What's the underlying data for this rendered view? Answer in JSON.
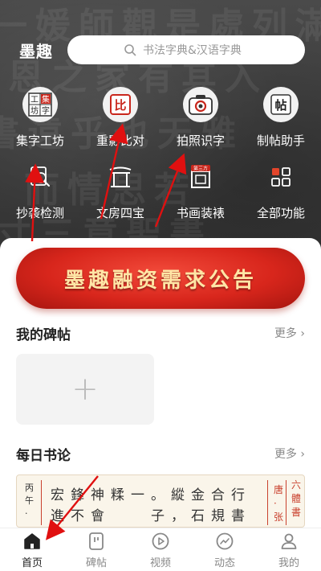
{
  "header": {
    "app_title": "墨趣",
    "search_placeholder": "书法字典&汉语字典"
  },
  "tools": [
    {
      "label": "集字工坊",
      "icon": "collect-chars-icon"
    },
    {
      "label": "重影比对",
      "icon": "compare-icon"
    },
    {
      "label": "拍照识字",
      "icon": "camera-icon"
    },
    {
      "label": "制帖助手",
      "icon": "tie-helper-icon"
    },
    {
      "label": "抄袭检测",
      "icon": "plagiarism-check-icon"
    },
    {
      "label": "文房四宝",
      "icon": "archway-icon"
    },
    {
      "label": "书画装裱",
      "icon": "frame-icon",
      "badge": "第三方"
    },
    {
      "label": "全部功能",
      "icon": "grid-icon"
    }
  ],
  "tool_glyphs": {
    "collect": [
      "工",
      "集",
      "坊",
      "字"
    ],
    "compare": "比",
    "tie": "帖"
  },
  "banner": {
    "text": "墨趣融资需求公告"
  },
  "my_tablets": {
    "title": "我的碑帖",
    "more": "更多",
    "add_symbol": "+"
  },
  "daily": {
    "title": "每日书论",
    "more": "更多",
    "quote_meta": [
      "丙",
      "午",
      "·"
    ],
    "quote_line1": "宏鋒神糅一。縱金合行",
    "quote_line2": "進不會　　子，石規書",
    "quote_author": [
      "唐",
      "·",
      "张"
    ],
    "quote_book": [
      "六",
      "體",
      "書"
    ]
  },
  "tabbar": [
    {
      "label": "首页",
      "icon": "home-icon",
      "active": true
    },
    {
      "label": "碑帖",
      "icon": "tablet-icon",
      "active": false
    },
    {
      "label": "视频",
      "icon": "video-icon",
      "active": false
    },
    {
      "label": "动态",
      "icon": "trend-icon",
      "active": false
    },
    {
      "label": "我的",
      "icon": "profile-icon",
      "active": false
    }
  ],
  "colors": {
    "annotation_arrow": "#e01010",
    "banner_red": "#d8261c",
    "banner_text": "#ffe6a6"
  }
}
